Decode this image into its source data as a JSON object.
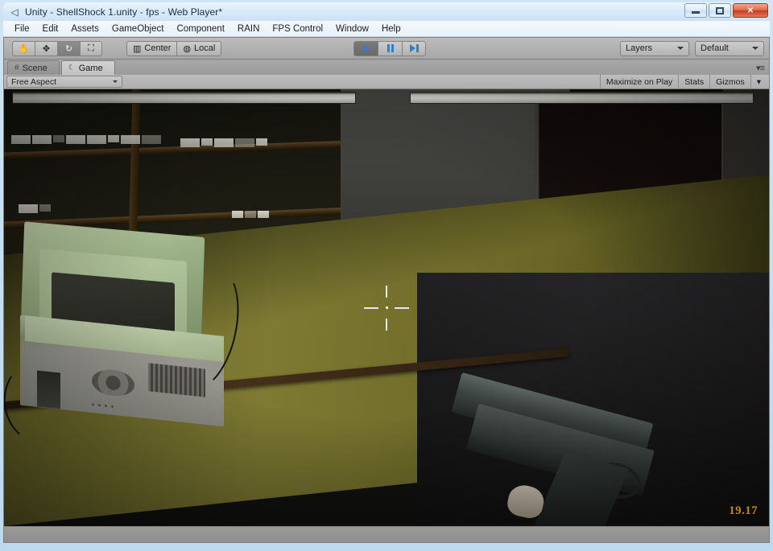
{
  "window": {
    "title": "Unity - ShellShock 1.unity - fps - Web Player*",
    "app_icon": "unity-icon",
    "minimize_label": "Minimize",
    "maximize_label": "Maximize",
    "close_label": "✕"
  },
  "menu": {
    "items": [
      {
        "label": "File"
      },
      {
        "label": "Edit"
      },
      {
        "label": "Assets"
      },
      {
        "label": "GameObject"
      },
      {
        "label": "Component"
      },
      {
        "label": "RAIN"
      },
      {
        "label": "FPS Control"
      },
      {
        "label": "Window"
      },
      {
        "label": "Help"
      }
    ]
  },
  "toolbar": {
    "transform_tools": [
      {
        "name": "hand-tool",
        "glyph": "✋",
        "active": false
      },
      {
        "name": "move-tool",
        "glyph": "✥",
        "active": false
      },
      {
        "name": "rotate-tool",
        "glyph": "↻",
        "active": true
      },
      {
        "name": "scale-tool",
        "glyph": "⛶",
        "active": false
      }
    ],
    "pivot_mode": "Center",
    "pivot_rotation": "Local",
    "pivot_icon": "pivot-icon",
    "rotation_icon": "globe-icon",
    "play_label": "Play",
    "pause_label": "Pause",
    "step_label": "Step",
    "is_playing": true,
    "layers_label": "Layers",
    "layout_label": "Default"
  },
  "tabs": [
    {
      "label": "Scene",
      "icon": "grid-icon",
      "active": false
    },
    {
      "label": "Game",
      "icon": "gamepad-icon",
      "active": true
    }
  ],
  "tab_menu_glyph": "▾≡",
  "game_toolbar": {
    "aspect": "Free Aspect",
    "maximize_on_play": "Maximize on Play",
    "stats": "Stats",
    "gizmos": "Gizmos",
    "gizmos_caret": "▾"
  },
  "game_view": {
    "scene_name": "ShellShock 1",
    "hud_timer": "19.17",
    "hud_timer_color": "#c8860a",
    "crosshair": "fps-crosshair",
    "objects": [
      "bookshelf-wall",
      "crt-monitor",
      "pc-tower",
      "doorway",
      "wooden-floor",
      "pistol-viewmodel"
    ]
  },
  "status_bar": {
    "message": ""
  }
}
